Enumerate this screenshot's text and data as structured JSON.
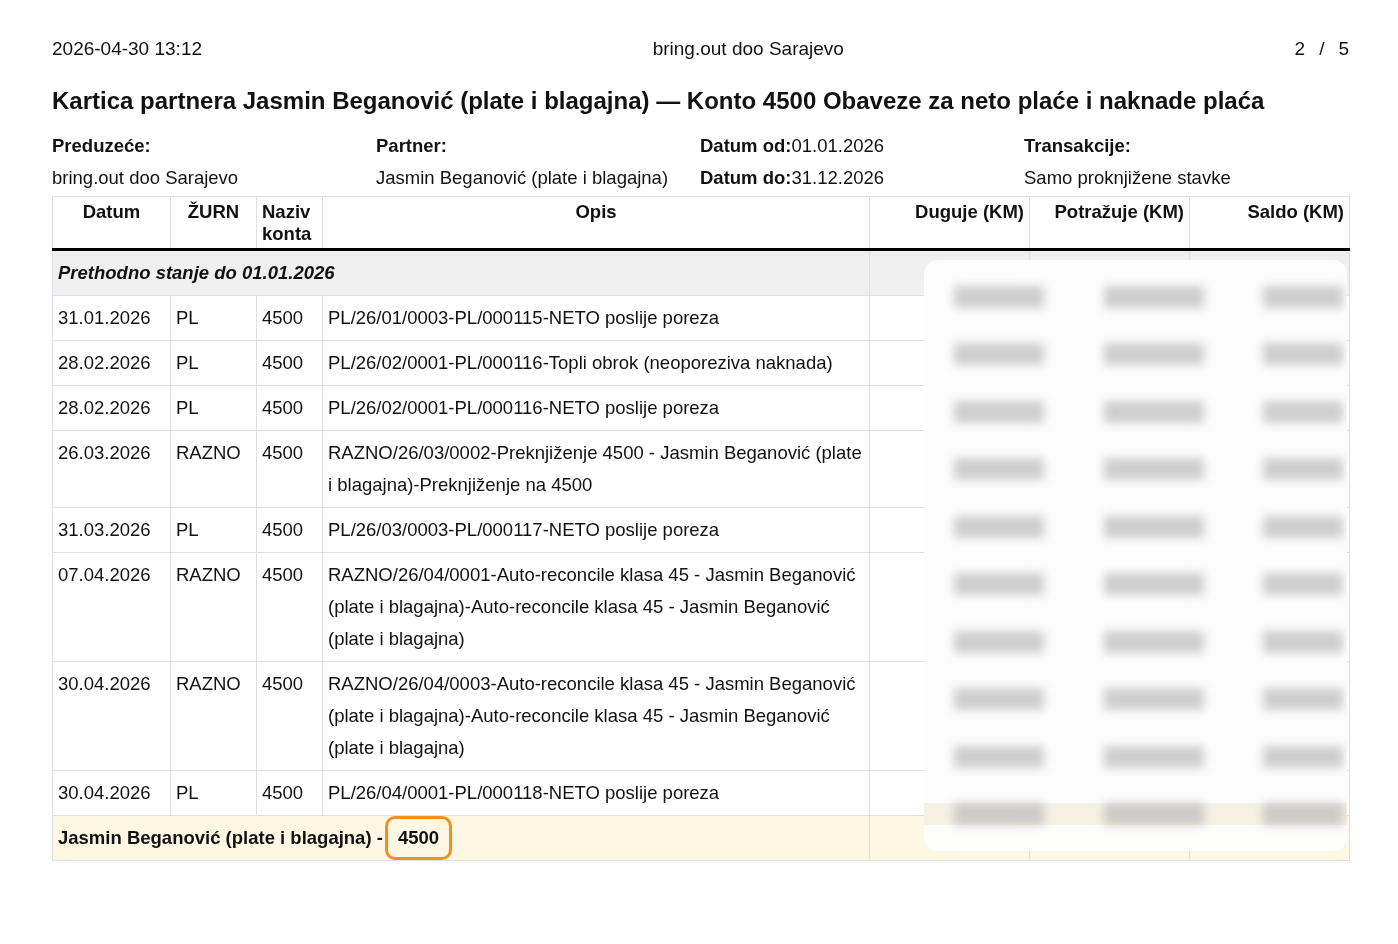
{
  "page_header": {
    "timestamp": "2026-04-30 13:12",
    "company": "bring.out doo Sarajevo",
    "page_current": "2",
    "page_separator": "/",
    "page_total": "5"
  },
  "title": "Kartica partnera Jasmin Beganović (plate i blagajna) — Konto 4500 Obaveze za neto plaće i naknade plaća",
  "info": [
    {
      "label": "Preduzeće:",
      "value": "bring.out doo Sarajevo",
      "kind": "stacked"
    },
    {
      "label": "Partner:",
      "value": "Jasmin Beganović (plate i blagajna)",
      "kind": "stacked"
    },
    {
      "kind": "inline",
      "lines": [
        {
          "label": "Datum od:",
          "value": "01.01.2026"
        },
        {
          "label": "Datum do:",
          "value": "31.12.2026"
        }
      ]
    },
    {
      "label": "Transakcije:",
      "value": "Samo proknjižene stavke",
      "kind": "stacked"
    }
  ],
  "table": {
    "columns": [
      "Datum",
      "ŽURN",
      "Naziv konta",
      "Opis",
      "Duguje (KM)",
      "Potražuje (KM)",
      "Saldo (KM)"
    ],
    "previous_balance": "Prethodno stanje do 01.01.2026",
    "rows": [
      {
        "date": "31.01.2026",
        "journal": "PL",
        "account": "4500",
        "description": "PL/26/01/0003-PL/000115-NETO poslije poreza"
      },
      {
        "date": "28.02.2026",
        "journal": "PL",
        "account": "4500",
        "description": "PL/26/02/0001-PL/000116-Topli obrok (neoporeziva naknada)"
      },
      {
        "date": "28.02.2026",
        "journal": "PL",
        "account": "4500",
        "description": "PL/26/02/0001-PL/000116-NETO poslije poreza"
      },
      {
        "date": "26.03.2026",
        "journal": "RAZNO",
        "account": "4500",
        "description": "RAZNO/26/03/0002-Preknjiženje 4500 - Jasmin Beganović (plate i blagajna)-Preknjiženje na 4500"
      },
      {
        "date": "31.03.2026",
        "journal": "PL",
        "account": "4500",
        "description": "PL/26/03/0003-PL/000117-NETO poslije poreza"
      },
      {
        "date": "07.04.2026",
        "journal": "RAZNO",
        "account": "4500",
        "description": "RAZNO/26/04/0001-Auto-reconcile klasa 45 - Jasmin Beganović (plate i blagajna)-Auto-reconcile klasa 45 - Jasmin Beganović (plate i blagajna)"
      },
      {
        "date": "30.04.2026",
        "journal": "RAZNO",
        "account": "4500",
        "description": "RAZNO/26/04/0003-Auto-reconcile klasa 45 - Jasmin Beganović (plate i blagajna)-Auto-reconcile klasa 45 - Jasmin Beganović (plate i blagajna)"
      },
      {
        "date": "30.04.2026",
        "journal": "PL",
        "account": "4500",
        "description": "PL/26/04/0001-PL/000118-NETO poslije poreza"
      }
    ],
    "footer": {
      "partner": "Jasmin Beganović (plate i blagajna) -",
      "account": "4500",
      "highlighted": true
    }
  }
}
